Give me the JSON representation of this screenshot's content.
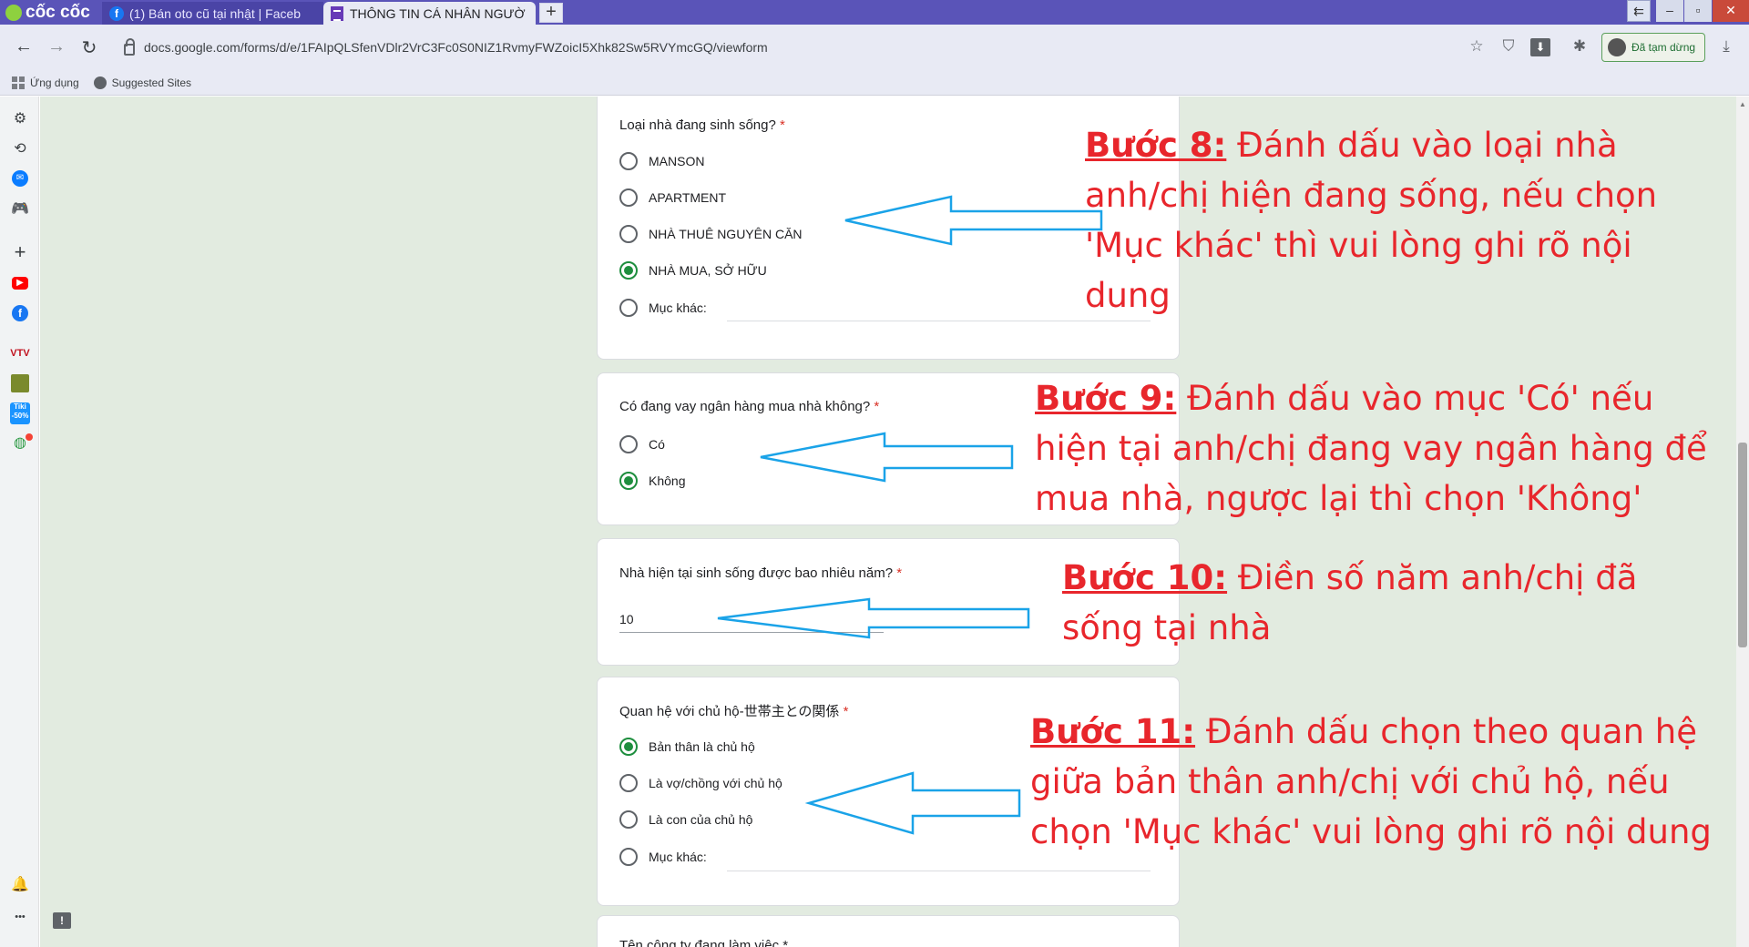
{
  "browser": {
    "brand": "cốc cốc",
    "tabs": [
      {
        "label": "(1) Bán oto cũ tại nhật | Faceb",
        "favicon": "f",
        "active": false
      },
      {
        "label": "THÔNG TIN CÁ NHÂN NGƯỜ",
        "active": true
      }
    ],
    "new_tab": "+",
    "url": "docs.google.com/forms/d/e/1FAIpQLSfenVDlr2VrC3Fc0S0NIZ1RvmyFWZoicI5Xhk82Sw5RVYmcGQ/viewform",
    "profile_label": "Đã tạm dừng",
    "bookmarks": [
      "Ứng dụng",
      "Suggested Sites"
    ]
  },
  "icons": {
    "back": "←",
    "forward": "→",
    "reload": "↻",
    "star": "☆",
    "shield": "⛉",
    "download": "⬇",
    "extensions": "✱",
    "download2": "⤓",
    "settings": "⚙",
    "history": "⟲",
    "messenger": "✉",
    "game": "🎮",
    "add": "+",
    "youtube": "▶",
    "facebook": "f",
    "vtv": "VTV",
    "tiki": "Tiki -50%",
    "bell": "🔔",
    "more": "•••",
    "feedback": "!"
  },
  "form": {
    "q8": {
      "question": "Loại nhà đang sinh sống?",
      "required_mark": "*",
      "options": [
        {
          "label": "MANSON",
          "selected": false
        },
        {
          "label": "APARTMENT",
          "selected": false
        },
        {
          "label": "NHÀ THUÊ NGUYÊN CĂN",
          "selected": false
        },
        {
          "label": "NHÀ MUA, SỞ HỮU",
          "selected": true
        },
        {
          "label": "Mục khác:",
          "selected": false
        }
      ]
    },
    "q9": {
      "question": "Có đang vay ngân hàng mua nhà không?",
      "required_mark": "*",
      "options": [
        {
          "label": "Có",
          "selected": false
        },
        {
          "label": "Không",
          "selected": true
        }
      ]
    },
    "q10": {
      "question": "Nhà hiện tại sinh sống được bao nhiêu năm?",
      "required_mark": "*",
      "answer": "10"
    },
    "q11": {
      "question": "Quan hệ với chủ hộ-世帯主との関係",
      "required_mark": "*",
      "options": [
        {
          "label": "Bản thân là chủ hộ",
          "selected": true
        },
        {
          "label": "Là vợ/chồng với chủ hộ",
          "selected": false
        },
        {
          "label": "Là con của chủ hộ",
          "selected": false
        },
        {
          "label": "Mục khác:",
          "selected": false
        }
      ]
    },
    "q12_partial": "Tên công ty đang làm việc *"
  },
  "annotations": {
    "step8": {
      "label": "Bước 8:",
      "text": " Đánh dấu vào loại nhà anh/chị hiện đang sống, nếu chọn 'Mục khác' thì vui lòng ghi rõ nội dung"
    },
    "step9": {
      "label": "Bước 9:",
      "text": " Đánh dấu vào mục 'Có' nếu hiện tại anh/chị đang vay ngân hàng để mua nhà, ngược lại thì chọn 'Không'"
    },
    "step10": {
      "label": "Bước 10:",
      "text": " Điền số năm anh/chị đã sống tại nhà"
    },
    "step11": {
      "label": "Bước 11:",
      "text": " Đánh dấu chọn theo quan hệ giữa bản thân anh/chị với chủ hộ, nếu chọn 'Mục khác' vui lòng ghi rõ nội dung"
    }
  },
  "colors": {
    "annotation_red": "#e8262c",
    "arrow_blue": "#1aa3e8",
    "radio_green": "#1e8e3e",
    "page_bg": "#e2ebe0",
    "tabbar": "#5a54b8"
  }
}
